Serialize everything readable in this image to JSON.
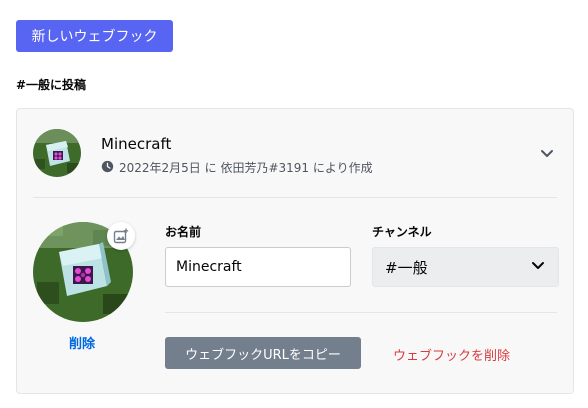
{
  "header": {
    "new_webhook_label": "新しいウェブフック",
    "post_to_label": "#一般に投稿"
  },
  "webhook": {
    "name": "Minecraft",
    "created_text": "2022年2月5日 に 依田芳乃#3191 により作成",
    "name_field_label": "お名前",
    "name_field_value": "Minecraft",
    "channel_field_label": "チャンネル",
    "channel_selected": "#一般",
    "remove_avatar_label": "削除",
    "copy_url_label": "ウェブフックURLをコピー",
    "delete_label": "ウェブフックを削除"
  },
  "icons": {
    "clock": "clock-icon",
    "chevron": "chevron-down-icon",
    "image_upload": "image-plus-icon"
  },
  "colors": {
    "brand": "#5865f2",
    "link": "#0068e0",
    "danger": "#d83c3e",
    "secondary_button": "#747f8d"
  }
}
